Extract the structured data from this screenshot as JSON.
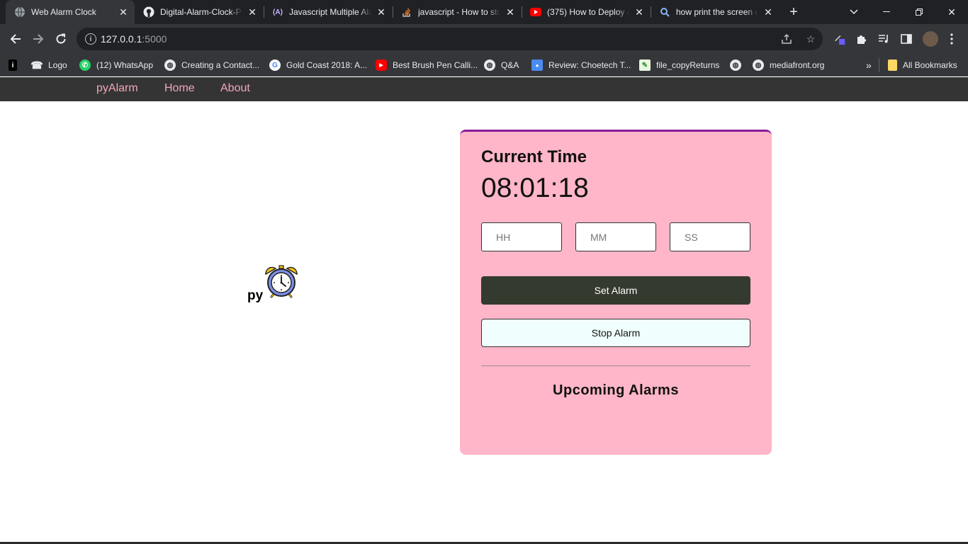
{
  "browser": {
    "tabs": [
      {
        "title": "Web Alarm Clock",
        "icon": "globe-icon",
        "active": true
      },
      {
        "title": "Digital-Alarm-Clock-Py",
        "icon": "github-icon"
      },
      {
        "title": "Javascript Multiple Ala",
        "icon": "code-icon"
      },
      {
        "title": "javascript - How to sto",
        "icon": "stackoverflow-icon"
      },
      {
        "title": "(375) How to Deploy a",
        "icon": "youtube-icon"
      },
      {
        "title": "how print the screen c",
        "icon": "search-icon"
      }
    ],
    "address": {
      "host": "127.0.0.1",
      "port": ":5000"
    },
    "bookmarks": [
      {
        "label": "",
        "icon": "bookmark-app-icon"
      },
      {
        "label": "Logo",
        "icon": "phone-icon"
      },
      {
        "label": "(12) WhatsApp",
        "icon": "whatsapp-icon"
      },
      {
        "label": "Creating a Contact...",
        "icon": "globe-icon"
      },
      {
        "label": "Gold Coast 2018: A...",
        "icon": "google-icon"
      },
      {
        "label": "Best Brush Pen Calli...",
        "icon": "youtube-icon"
      },
      {
        "label": "Q&A",
        "icon": "globe-icon"
      },
      {
        "label": "Review: Choetech T...",
        "icon": "bookmark-blue-icon"
      },
      {
        "label": "file_copyReturns",
        "icon": "bookmark-green-icon"
      },
      {
        "label": "",
        "icon": "globe-icon"
      },
      {
        "label": "mediafront.org",
        "icon": "globe-icon"
      }
    ],
    "more_bookmarks": "»",
    "all_bookmarks": "All Bookmarks"
  },
  "site_nav": {
    "brand": "pyAlarm",
    "links": [
      "Home",
      "About"
    ]
  },
  "logo": {
    "text": "py",
    "icon": "alarm-clock-icon"
  },
  "alarm_card": {
    "heading": "Current Time",
    "current_time": "08:01:18",
    "inputs": {
      "hh_placeholder": "HH",
      "mm_placeholder": "MM",
      "ss_placeholder": "SS"
    },
    "set_button": "Set Alarm",
    "stop_button": "Stop Alarm",
    "upcoming_heading": "Upcoming Alarms"
  },
  "colors": {
    "card_bg": "#ffb6c8",
    "card_accent": "#8b1a9a",
    "nav_bg": "#343434",
    "nav_link": "#f4a6b9",
    "set_btn": "#343a2d",
    "stop_btn": "#f0fffe"
  }
}
